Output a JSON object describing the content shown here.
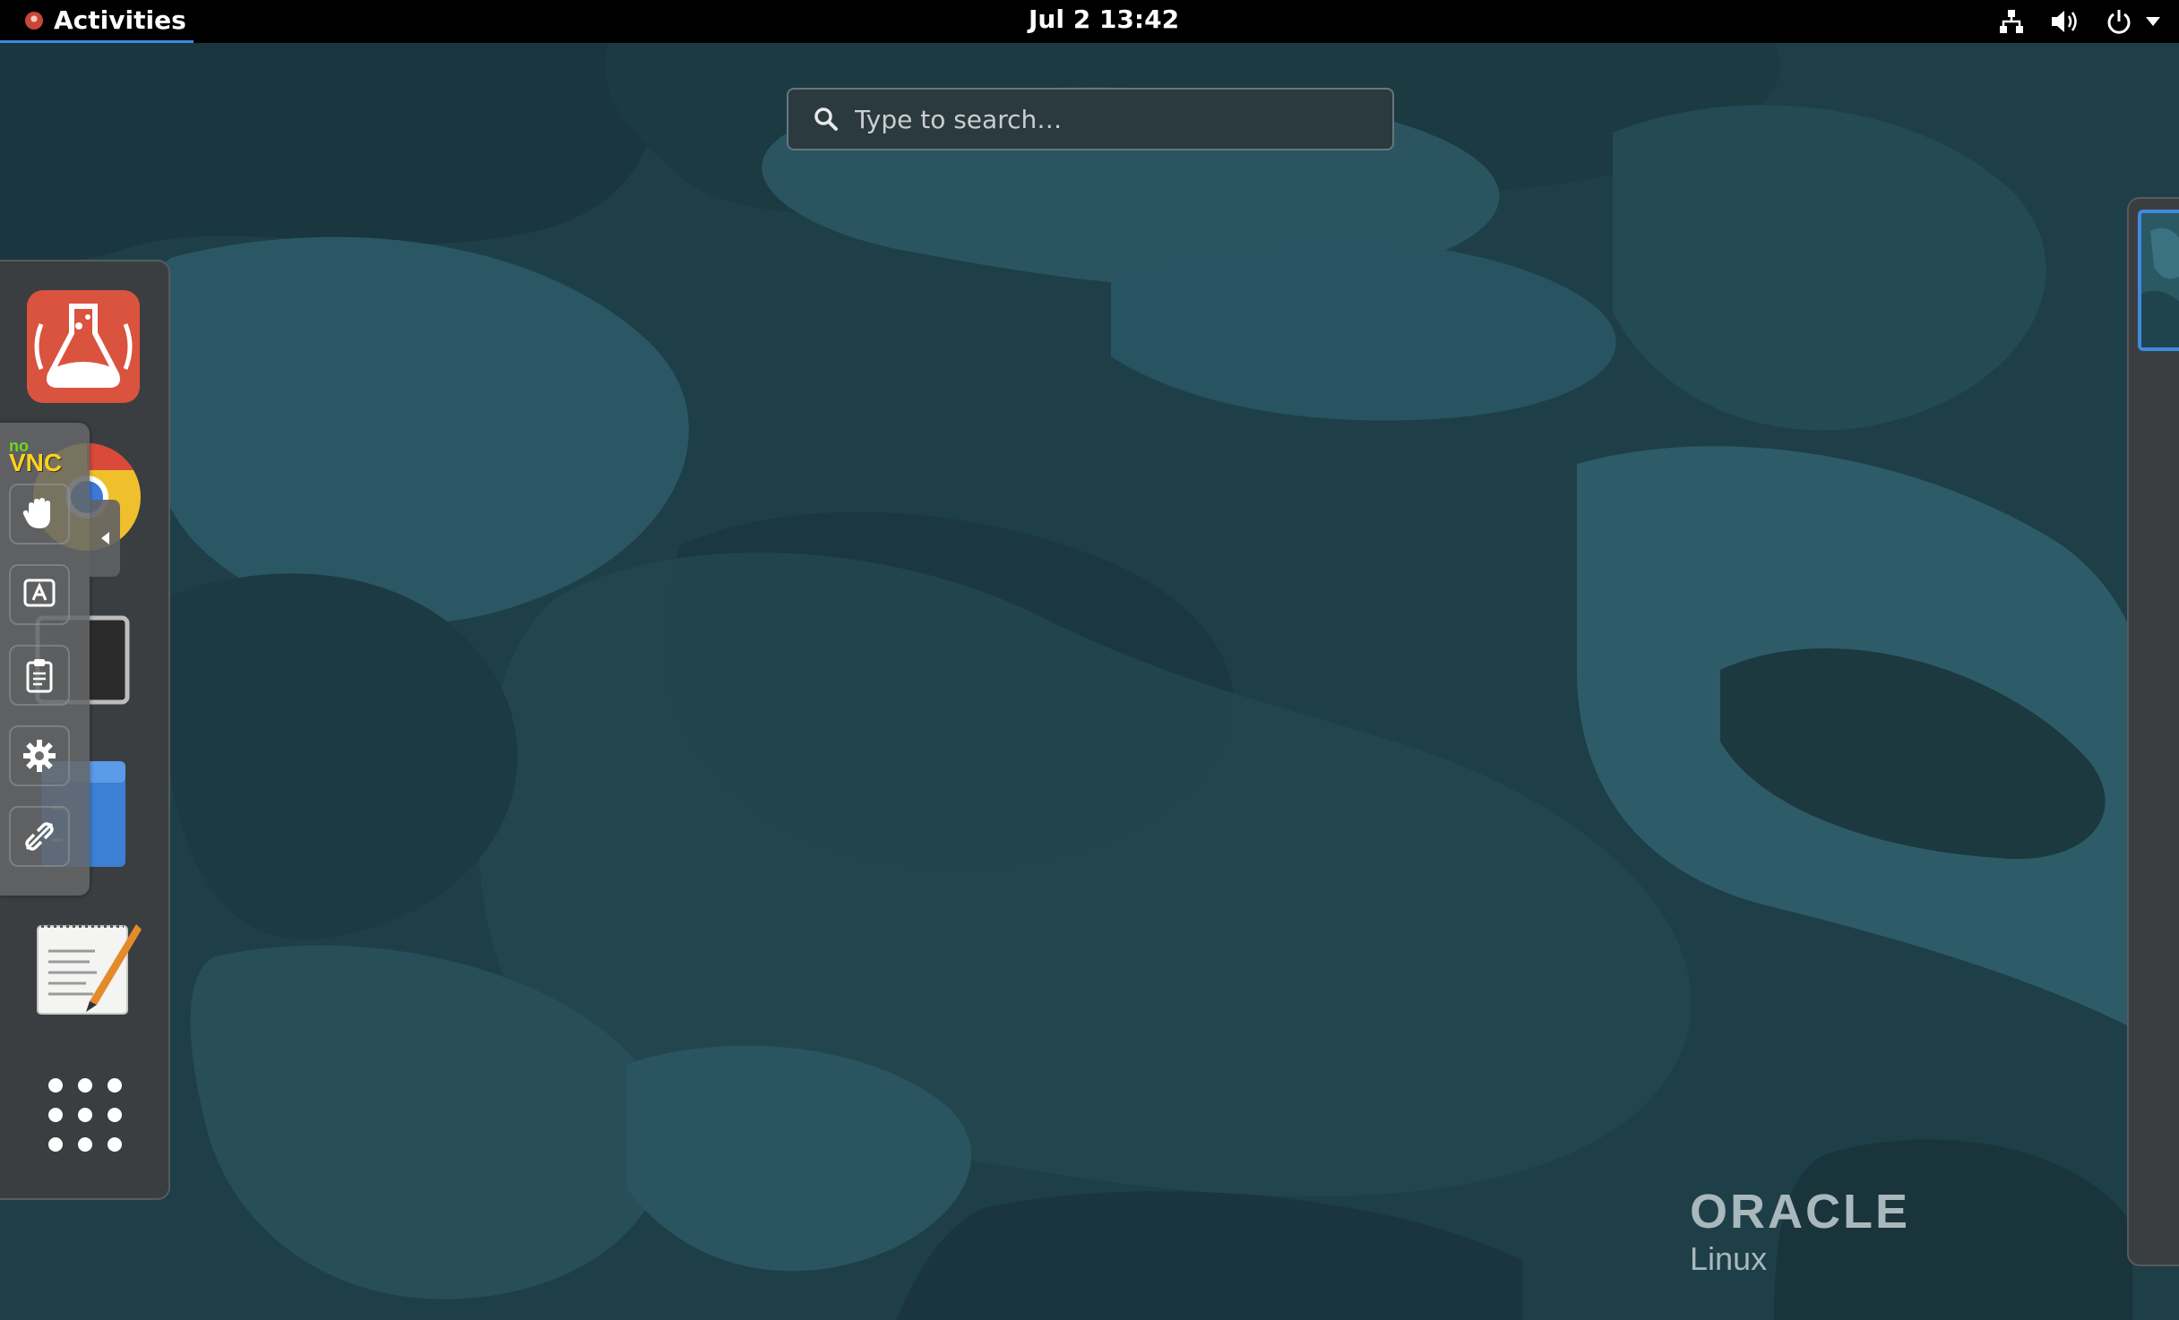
{
  "topbar": {
    "activities_label": "Activities",
    "clock": "Jul 2  13:42",
    "tray_icons": [
      "network-icon",
      "volume-icon",
      "power-icon",
      "chevron-down-icon"
    ]
  },
  "search": {
    "placeholder": "Type to search…"
  },
  "dash": {
    "apps": [
      {
        "name": "Application Lab",
        "icon": "flask-app-icon",
        "color": "#d9533f"
      },
      {
        "name": "Google Chrome",
        "icon": "chrome-icon"
      },
      {
        "name": "Terminal",
        "icon": "terminal-icon"
      },
      {
        "name": "Files",
        "icon": "files-icon",
        "color": "#3c7fd3"
      },
      {
        "name": "Text Editor",
        "icon": "text-editor-icon"
      }
    ],
    "show_apps_icon": "app-grid-icon"
  },
  "novnc": {
    "logo_top": "no",
    "logo_bottom": "VNC",
    "buttons": [
      "drag-viewport-icon",
      "keyboard-icon",
      "clipboard-icon",
      "settings-icon",
      "disconnect-icon"
    ],
    "handle_icon": "collapse-arrow-icon"
  },
  "wallpaper": {
    "brand": "ORACLE",
    "product": "Linux"
  },
  "colors": {
    "accent": "#3f8ae0",
    "wallpaper": "#1d3e47",
    "topbar": "#000000"
  }
}
